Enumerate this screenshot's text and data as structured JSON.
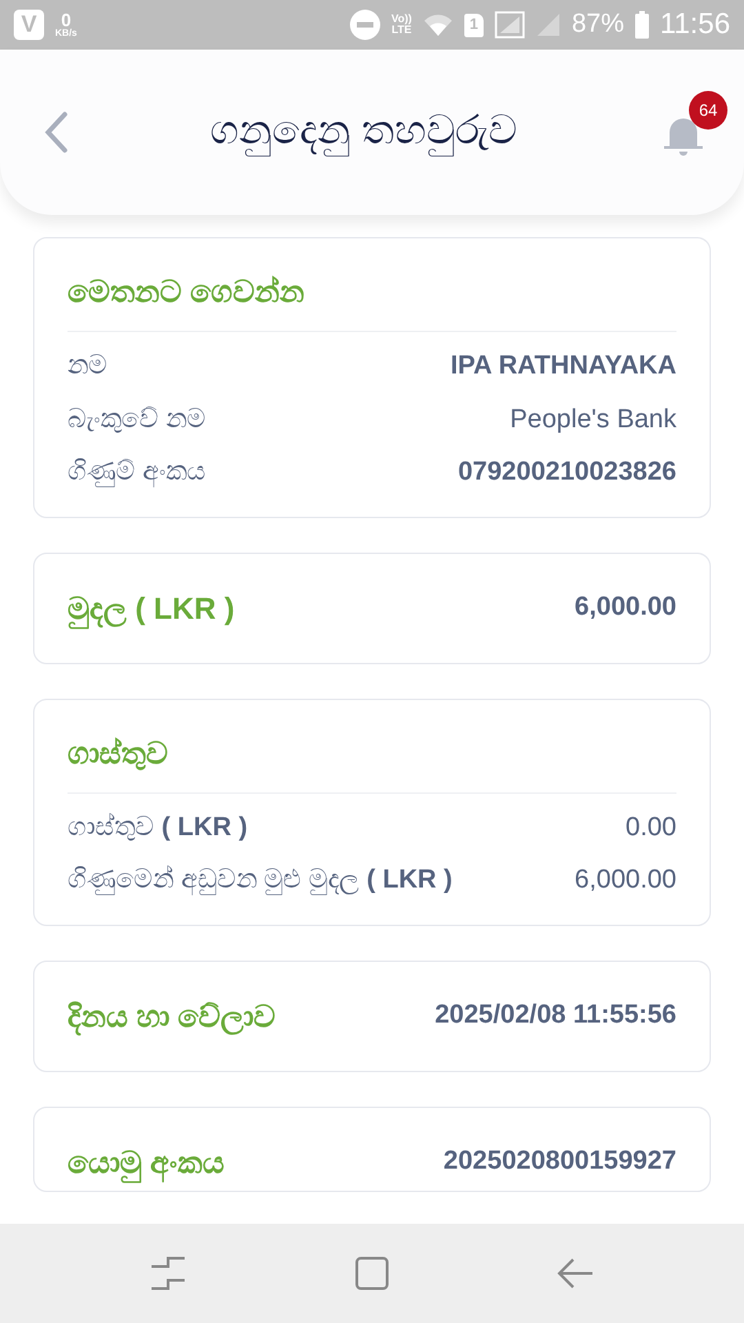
{
  "status_bar": {
    "app_badge": "V",
    "net_speed": "0",
    "net_unit": "KB/s",
    "volte_top": "Vo))",
    "volte_bottom": "LTE",
    "sim": "1",
    "battery": "87%",
    "time": "11:56"
  },
  "header": {
    "title": "ගනුදෙනු තහවුරුව",
    "notification_count": "64"
  },
  "sections": [
    {
      "kind": "details",
      "title": "මෙතනට ගෙවන්න",
      "rows": [
        {
          "label": "නම",
          "value": "IPA RATHNAYAKA",
          "emphasis": true
        },
        {
          "label": "බැංකුවේ නම",
          "value": "People's Bank",
          "emphasis": false
        },
        {
          "label": "ගිණුම් අංකය",
          "value": "079200210023826",
          "emphasis": true
        }
      ]
    },
    {
      "kind": "summary",
      "title": "මුදල ( LKR )",
      "value": "6,000.00"
    },
    {
      "kind": "details",
      "title": "ගාස්තුව",
      "rows": [
        {
          "label": "ගාස්තුව **( LKR )**",
          "value": "0.00",
          "emphasis": false
        },
        {
          "label": "ගිණුමෙන් අඩුවන මුළු මුදල **( LKR )**",
          "value": "6,000.00",
          "emphasis": false
        }
      ]
    },
    {
      "kind": "summary",
      "title": "දිනය හා වේලාව",
      "value": "2025/02/08 11:55:56"
    },
    {
      "kind": "summary",
      "title": "යොමු අංකය",
      "value": "2025020800159927"
    }
  ]
}
